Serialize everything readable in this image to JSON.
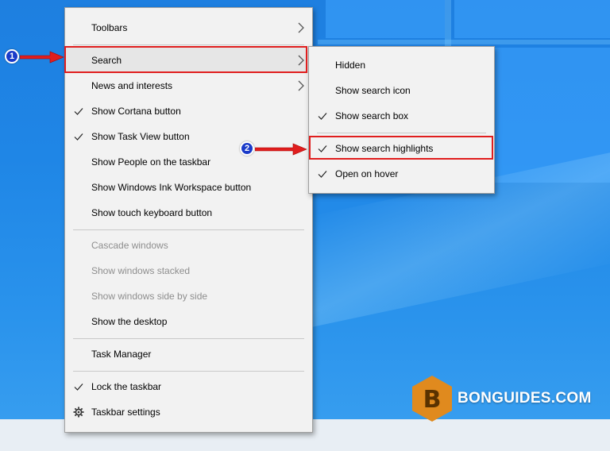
{
  "main_menu": {
    "items": [
      {
        "label": "Toolbars"
      },
      {
        "label": "Search"
      },
      {
        "label": "News and interests"
      },
      {
        "label": "Show Cortana button"
      },
      {
        "label": "Show Task View button"
      },
      {
        "label": "Show People on the taskbar"
      },
      {
        "label": "Show Windows Ink Workspace button"
      },
      {
        "label": "Show touch keyboard button"
      },
      {
        "label": "Cascade windows"
      },
      {
        "label": "Show windows stacked"
      },
      {
        "label": "Show windows side by side"
      },
      {
        "label": "Show the desktop"
      },
      {
        "label": "Task Manager"
      },
      {
        "label": "Lock the taskbar"
      },
      {
        "label": "Taskbar settings"
      }
    ]
  },
  "search_submenu": {
    "items": [
      {
        "label": "Hidden"
      },
      {
        "label": "Show search icon"
      },
      {
        "label": "Show search box"
      },
      {
        "label": "Show search highlights"
      },
      {
        "label": "Open on hover"
      }
    ]
  },
  "annotations": {
    "step1": "1",
    "step2": "2",
    "highlight_color": "#e01e1e",
    "badge_color": "#1a3bc9"
  },
  "watermark": {
    "letter": "B",
    "text": "BONGUIDES.COM",
    "hex_color": "#e08a1e"
  },
  "icons": {
    "check": "checkmark-icon",
    "submenu": "chevron-right-icon",
    "settings": "gear-icon"
  }
}
